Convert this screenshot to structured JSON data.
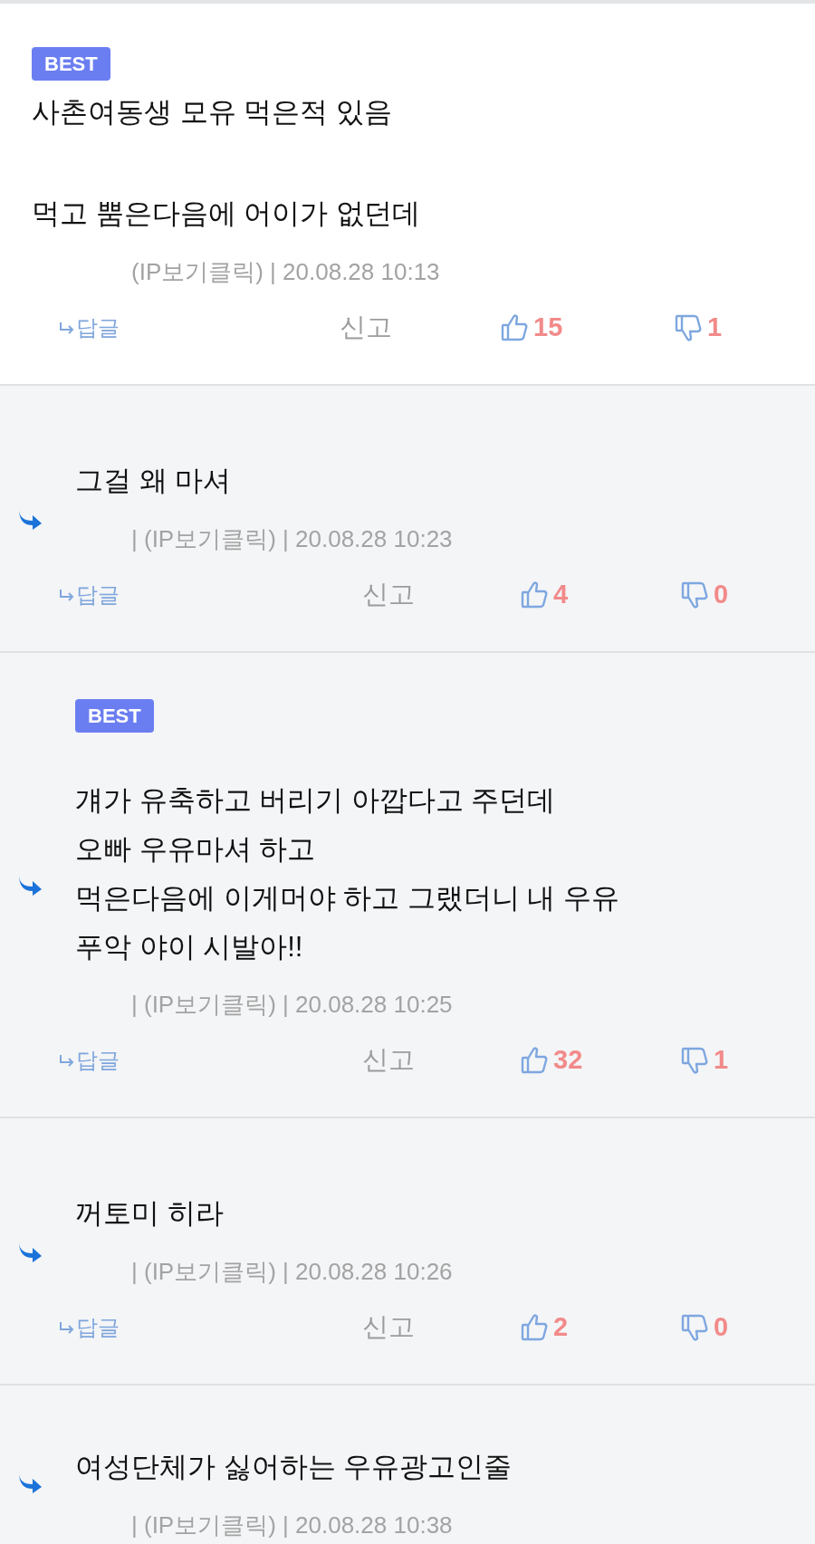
{
  "comments": [
    {
      "kind": "comment",
      "badge": "BEST",
      "text": "사촌여동생 모유 먹은적 있음\n\n먹고 뿜은다음에 어이가 없던데",
      "meta": "(IP보기클릭) | 20.08.28 10:13",
      "reply_label": "답글",
      "report_label": "신고",
      "likes": "15",
      "dislikes": "1"
    },
    {
      "kind": "reply",
      "text": "그걸 왜 마셔",
      "meta": "| (IP보기클릭) | 20.08.28 10:23",
      "reply_label": "답글",
      "report_label": "신고",
      "likes": "4",
      "dislikes": "0"
    },
    {
      "kind": "reply",
      "badge": "BEST",
      "text": "걔가 유축하고 버리기 아깝다고 주던데\n오빠 우유마셔 하고\n먹은다음에 이게머야 하고 그랬더니 내 우유\n푸악 야이 시발아!!",
      "meta": "| (IP보기클릭) | 20.08.28 10:25",
      "reply_label": "답글",
      "report_label": "신고",
      "likes": "32",
      "dislikes": "1"
    },
    {
      "kind": "reply",
      "text": "꺼토미 히라",
      "meta": "| (IP보기클릭) | 20.08.28 10:26",
      "reply_label": "답글",
      "report_label": "신고",
      "likes": "2",
      "dislikes": "0"
    },
    {
      "kind": "reply",
      "text": "여성단체가 싫어하는 우유광고인줄",
      "meta": "| (IP보기클릭) | 20.08.28 10:38"
    }
  ]
}
